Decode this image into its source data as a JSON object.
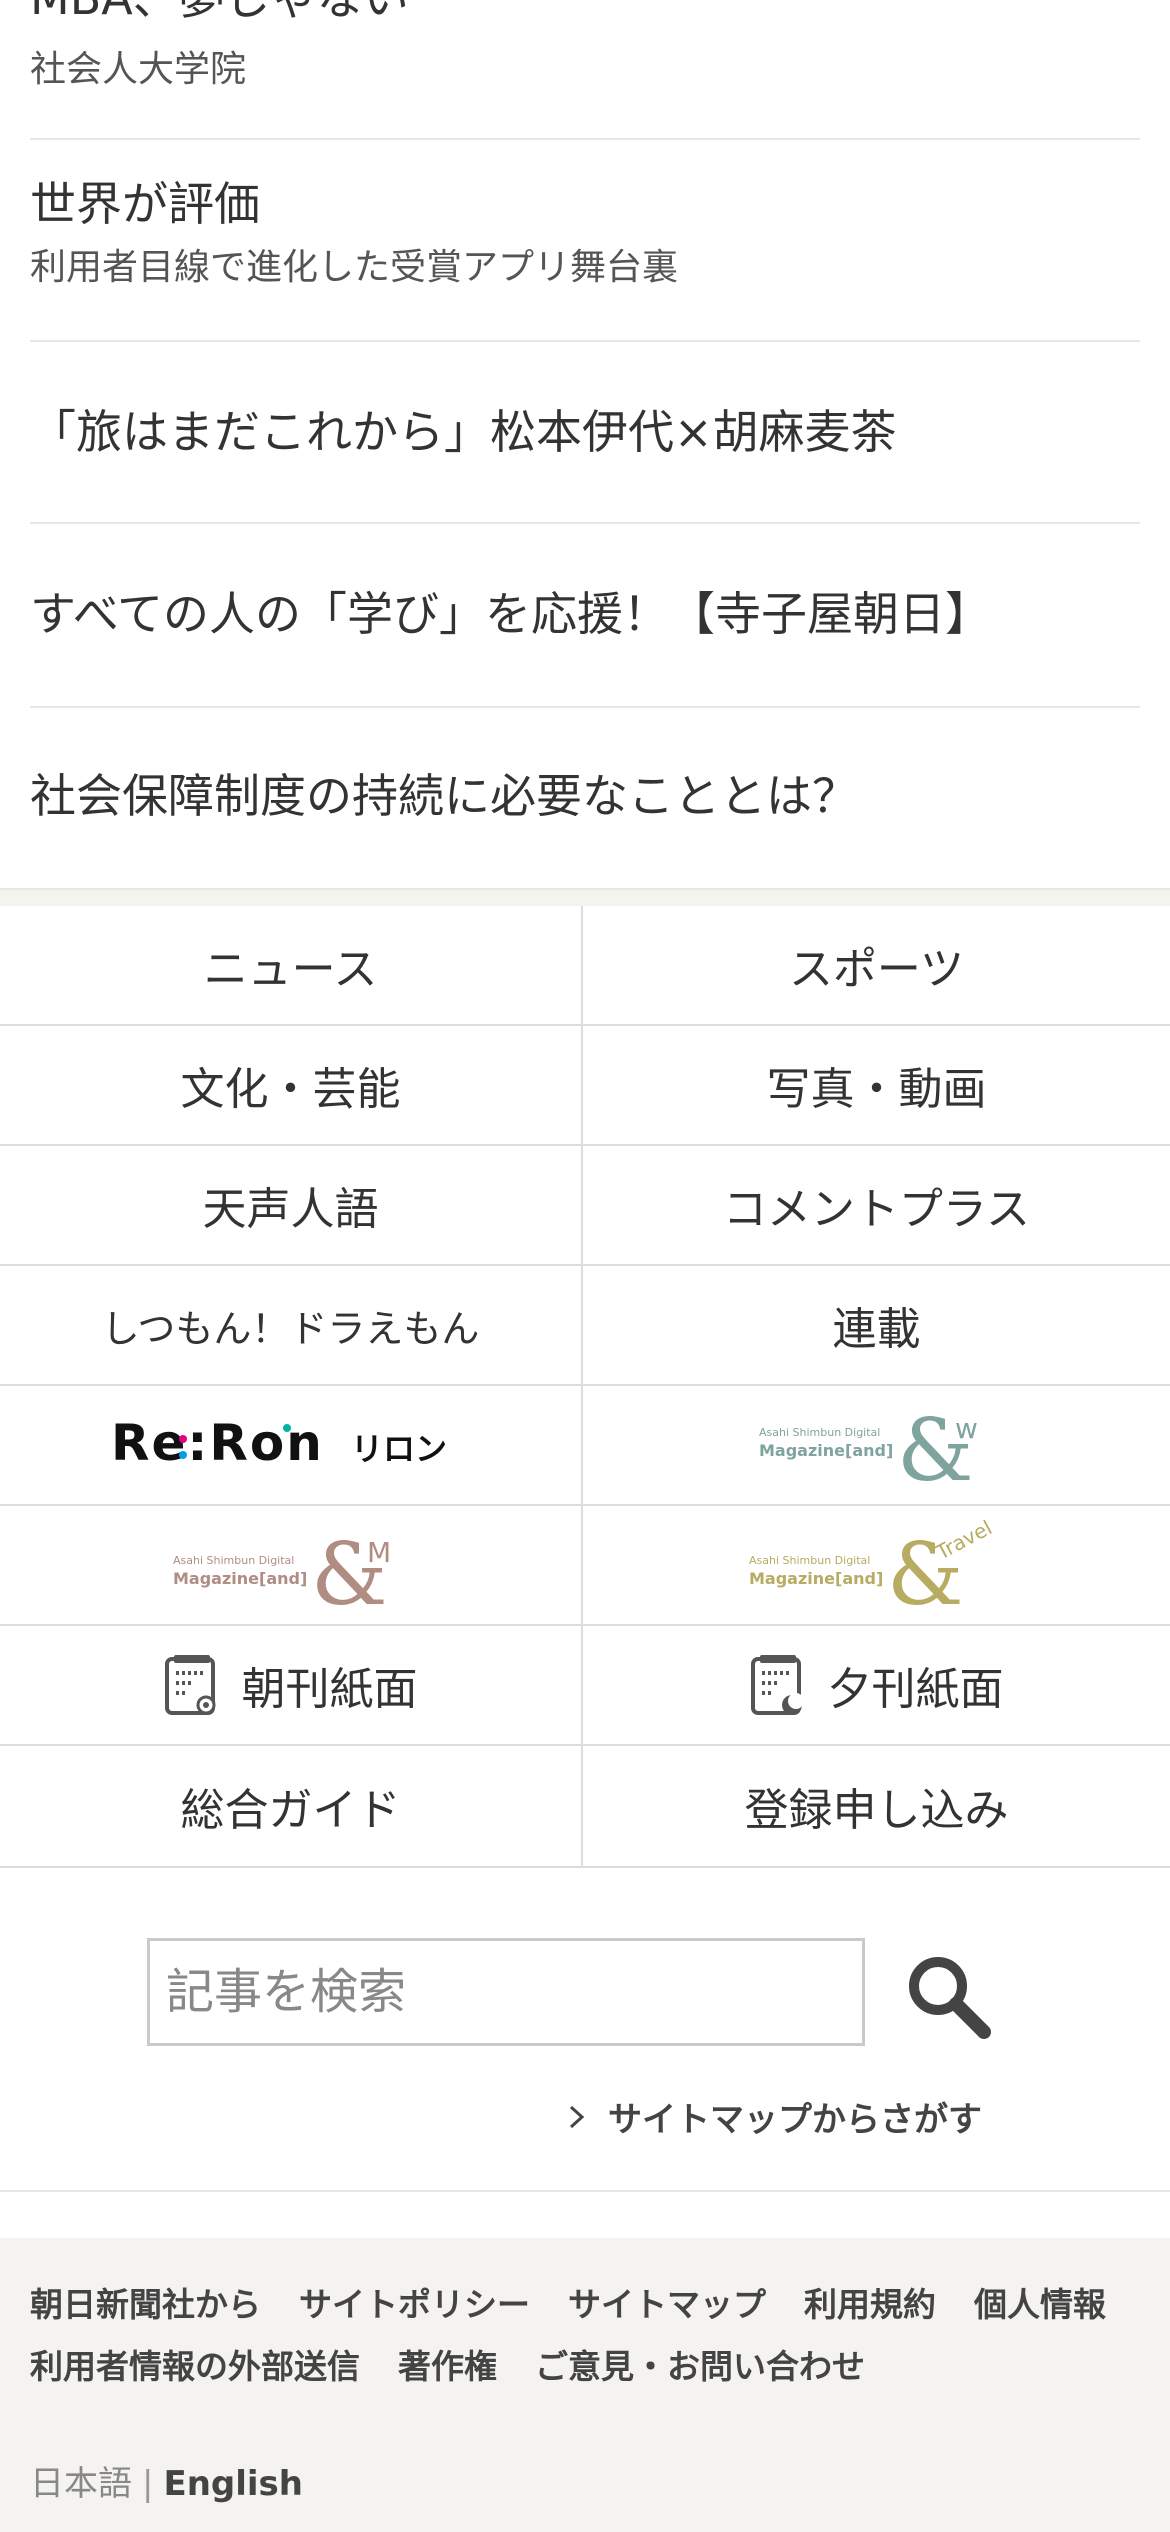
{
  "promo_links": [
    {
      "title": "MBA、夢じゃない",
      "subtitle": "社会人大学院"
    },
    {
      "title": "世界が評価",
      "subtitle": "利用者目線で進化した受賞アプリ舞台裏"
    },
    {
      "title": "「旅はまだこれから」松本伊代×胡麻麦茶"
    },
    {
      "title": "すべての人の「学び」を応援！【寺子屋朝日】"
    },
    {
      "title": "社会保障制度の持続に必要なこととは？"
    }
  ],
  "nav_grid": {
    "news": "ニュース",
    "sports": "スポーツ",
    "culture": "文化・芸能",
    "photo_video": "写真・動画",
    "tenseijingo": "天声人語",
    "comment_plus": "コメントプラス",
    "doraemon": "しつもん！ドラえもん",
    "serial": "連載",
    "reron": {
      "logo_text": "Re:Ron",
      "kana": "リロン"
    },
    "andw": {
      "line1": "Asahi Shimbun Digital",
      "line2": "Magazine[and]",
      "mark": "&",
      "suffix": "w"
    },
    "andm": {
      "line1": "Asahi Shimbun Digital",
      "line2": "Magazine[and]",
      "mark": "&",
      "suffix": "M"
    },
    "andtravel": {
      "line1": "Asahi Shimbun Digital",
      "line2": "Magazine[and]",
      "mark": "&",
      "suffix": "Travel"
    },
    "morning_paper": "朝刊紙面",
    "evening_paper": "夕刊紙面",
    "guide": "総合ガイド",
    "register": "登録申し込み"
  },
  "search": {
    "placeholder": "記事を検索",
    "value": "",
    "sitemap_link": "サイトマップからさがす"
  },
  "footer": {
    "row1": [
      "朝日新聞社から",
      "サイトポリシー",
      "サイトマップ",
      "利用規約",
      "個人情報"
    ],
    "row2": [
      "利用者情報の外部送信",
      "著作権",
      "ご意見・お問い合わせ"
    ],
    "lang_ja": "日本語",
    "lang_sep": "|",
    "lang_en": "English"
  },
  "colors": {
    "andw_accent": "#7fa39d",
    "andm_accent": "#b08d83",
    "andtravel_accent": "#b8ab62",
    "footer_bg": "#f4f3ef"
  }
}
